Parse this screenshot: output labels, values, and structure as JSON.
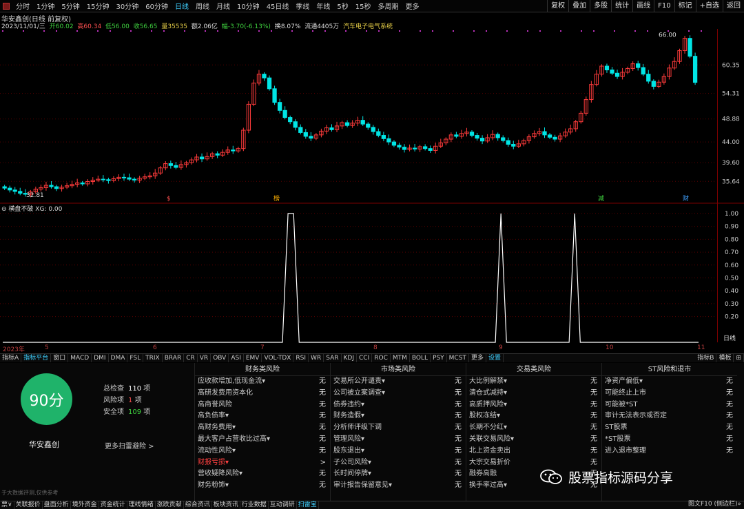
{
  "toolbar": {
    "timeframes": [
      "分时",
      "1分钟",
      "5分钟",
      "15分钟",
      "30分钟",
      "60分钟",
      "日线",
      "周线",
      "月线",
      "10分钟",
      "45日线",
      "季线",
      "年线",
      "5秒",
      "15秒",
      "多周期",
      "更多"
    ],
    "active_timeframe": "日线",
    "right_buttons": [
      "复权",
      "叠加",
      "多股",
      "统计",
      "画线",
      "F10",
      "标记",
      "+自选",
      "返回"
    ]
  },
  "stock": {
    "title": "华安鑫创(日线 前复权)",
    "date": "2023/11/01/三",
    "open": "开60.02",
    "high": "高60.34",
    "low": "低56.00",
    "close": "收56.65",
    "volume": "量35535",
    "amount": "额2.06亿",
    "change": "幅-3.70(-6.13%)",
    "turnover": "换8.07%",
    "float": "流通4405万",
    "sector": "汽车电子电气系统"
  },
  "chart_data": [
    {
      "type": "candlestick",
      "title": "华安鑫创(日线 前复权)",
      "y_ticks": [
        "60.35",
        "54.31",
        "48.88",
        "44.00",
        "39.60",
        "35.64"
      ],
      "annotations": [
        "66.00",
        "32.81"
      ],
      "x_ticks": [
        "2023年",
        "5",
        "6",
        "7",
        "8",
        "9",
        "10",
        "11"
      ],
      "markers": [
        "$",
        "榜",
        "减",
        "财"
      ],
      "close_series": [
        34.2,
        33.8,
        33.5,
        33.1,
        32.9,
        33.4,
        34.0,
        34.3,
        34.8,
        34.5,
        34.1,
        34.4,
        34.7,
        35.0,
        35.3,
        35.1,
        35.6,
        35.9,
        36.1,
        36.0,
        35.8,
        36.2,
        36.5,
        36.4,
        36.1,
        35.9,
        36.3,
        36.6,
        36.8,
        37.4,
        38.5,
        39.4,
        39.0,
        38.6,
        39.2,
        39.6,
        40.2,
        40.8,
        40.4,
        40.9,
        41.5,
        41.2,
        41.8,
        42.3,
        42.1,
        42.6,
        46.5,
        52.0,
        56.5,
        58.4,
        57.6,
        55.3,
        52.4,
        50.7,
        49.2,
        48.3,
        47.1,
        46.0,
        45.2,
        44.8,
        45.5,
        46.3,
        47.0,
        46.6,
        47.4,
        48.1,
        47.5,
        48.0,
        48.6,
        47.8,
        47.1,
        46.2,
        45.4,
        44.7,
        44.0,
        43.3,
        42.9,
        42.4,
        42.7,
        42.5,
        43.0,
        42.6,
        42.2,
        43.1,
        43.8,
        44.6,
        45.5,
        45.2,
        45.8,
        46.1,
        45.4,
        44.8,
        44.2,
        44.9,
        45.6,
        44.9,
        44.3,
        43.5,
        43.1,
        43.6,
        44.3,
        45.1,
        45.8,
        46.2,
        45.5,
        45.0,
        44.6,
        45.3,
        46.1,
        46.8,
        48.3,
        50.1,
        53.0,
        56.2,
        58.4,
        60.1,
        59.3,
        58.6,
        57.9,
        58.8,
        59.6,
        60.6,
        59.8,
        58.4,
        56.9,
        55.8,
        56.7,
        57.9,
        59.7,
        61.1,
        63.4,
        66.0,
        62.2,
        56.65
      ]
    },
    {
      "type": "line",
      "title": "横盘不破",
      "series": [
        {
          "name": "XG",
          "current": "0.00"
        }
      ],
      "y_ticks": [
        "1.00",
        "0.90",
        "0.80",
        "0.70",
        "0.60",
        "0.50",
        "0.40",
        "0.30",
        "0.20"
      ],
      "ylim": [
        0,
        1
      ],
      "spikes": [
        {
          "start": 0.402,
          "peak_start": 0.41,
          "peak_end": 0.418,
          "end": 0.426
        },
        {
          "start": 0.708,
          "peak": 0.716,
          "end": 0.724
        },
        {
          "start": 0.814,
          "peak": 0.822,
          "end": 0.83
        }
      ]
    }
  ],
  "indicator_title": "横盘不破 XG: 0.00",
  "right_axis_label": "日线",
  "tabs": [
    "指标A",
    "指标平台",
    "窗口",
    "MACD",
    "DMI",
    "DMA",
    "FSL",
    "TRIX",
    "BRAR",
    "CR",
    "VR",
    "OBV",
    "ASI",
    "EMV",
    "VOL-TDX",
    "RSI",
    "WR",
    "SAR",
    "KDJ",
    "CCI",
    "ROC",
    "MTM",
    "BOLL",
    "PSY",
    "MCST",
    "更多",
    "设置"
  ],
  "tabs_right": [
    "指标B",
    "模板",
    "⊞"
  ],
  "scan": {
    "score": "90分",
    "company": "华安鑫创",
    "total_label": "总检查",
    "total_value": "110",
    "total_unit": "项",
    "risk_label": "风险项",
    "risk_value": "1",
    "risk_unit": "项",
    "safe_label": "安全项",
    "safe_value": "109",
    "safe_unit": "项",
    "more": "更多扫雷避险 >"
  },
  "risk_columns": [
    {
      "title": "财务类风险",
      "items": [
        {
          "label": "应收款增加,低现金流▾",
          "value": "无"
        },
        {
          "label": "高研发费用资本化",
          "value": "无"
        },
        {
          "label": "高商誉风险",
          "value": "无"
        },
        {
          "label": "高负债率▾",
          "value": "无"
        },
        {
          "label": "高财务费用▾",
          "value": "无"
        },
        {
          "label": "最大客户占营收比过高▾",
          "value": "无"
        },
        {
          "label": "流动性风险▾",
          "value": "无"
        },
        {
          "label": "财报亏损▾",
          "value": ">",
          "highlight": true
        },
        {
          "label": "营收疑降风险▾",
          "value": "无"
        },
        {
          "label": "财务粉饰▾",
          "value": "无"
        }
      ]
    },
    {
      "title": "市场类风险",
      "items": [
        {
          "label": "交易所公开谴责▾",
          "value": "无"
        },
        {
          "label": "公司被立案调查▾",
          "value": "无"
        },
        {
          "label": "债券违约▾",
          "value": "无"
        },
        {
          "label": "财务造假▾",
          "value": "无"
        },
        {
          "label": "分析师评级下调",
          "value": "无"
        },
        {
          "label": "管理风险▾",
          "value": "无"
        },
        {
          "label": "股东退出▾",
          "value": "无"
        },
        {
          "label": "子公司风险▾",
          "value": "无"
        },
        {
          "label": "长时间停牌▾",
          "value": "无"
        },
        {
          "label": "审计报告保留意见▾",
          "value": "无"
        }
      ]
    },
    {
      "title": "交易类风险",
      "items": [
        {
          "label": "大比例解禁▾",
          "value": "无"
        },
        {
          "label": "清仓式减持▾",
          "value": "无"
        },
        {
          "label": "高质押风险▾",
          "value": "无"
        },
        {
          "label": "股权冻结▾",
          "value": "无"
        },
        {
          "label": "长期不分红▾",
          "value": "无"
        },
        {
          "label": "关联交易风险▾",
          "value": "无"
        },
        {
          "label": "北上资金卖出",
          "value": "无"
        },
        {
          "label": "大宗交易折价",
          "value": "无"
        },
        {
          "label": "融券高融",
          "value": "无"
        },
        {
          "label": "换手率过高▾",
          "value": "无"
        }
      ]
    },
    {
      "title": "ST风险和退市",
      "items": [
        {
          "label": "净资产偏低▾",
          "value": "无"
        },
        {
          "label": "可能终止上市",
          "value": "无"
        },
        {
          "label": "可能被*ST",
          "value": "无"
        },
        {
          "label": "审计无法表示或否定",
          "value": "无"
        },
        {
          "label": "ST股票",
          "value": "无"
        },
        {
          "label": "*ST股票",
          "value": "无"
        },
        {
          "label": "进入退市整理",
          "value": "无"
        }
      ]
    }
  ],
  "disclaimer": "于大数据评测,仅供参考",
  "watermark": "股票指标源码分享",
  "bottom_tabs": [
    "票∨",
    "关联报价",
    "盘面分析",
    "境外资金",
    "资金统计",
    "理线情绪",
    "涨跌贡献",
    "综合资讯",
    "板块资讯",
    "行业数据",
    "互动调研",
    "扫雷宝"
  ],
  "bottom_active": "扫雷宝",
  "bottom_right": "图文F10  (侧边栏)»",
  "colors": {
    "up": "#ff3b3b",
    "down": "#00e5e5",
    "grid": "#5a0000",
    "spike": "#ffffff",
    "score": "#1fb36a"
  }
}
